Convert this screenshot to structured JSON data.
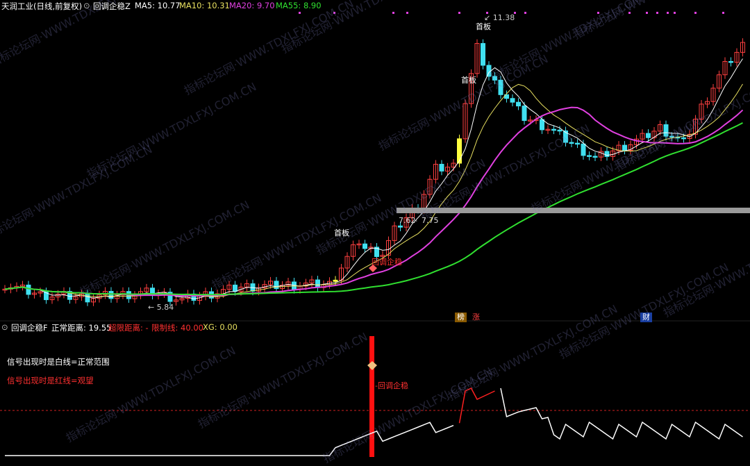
{
  "header": {
    "stock": "天润工业(日线,前复权)",
    "indicator": "回调企稳Z",
    "ma5": "MA5: 10.77",
    "ma10": "MA10: 10.31",
    "ma20": "MA20: 9.70",
    "ma55": "MA55: 8.90"
  },
  "colors": {
    "up": "#ff4040",
    "down": "#40e0f0",
    "ma5": "#ffffff",
    "ma10": "#e8e060",
    "ma20": "#e040e0",
    "ma55": "#30e030",
    "limit": "#ffff40"
  },
  "price_labels": {
    "high": "11.38",
    "low": "5.84",
    "range_low": "7.62",
    "range_high": "7.75"
  },
  "signals": {
    "first_board_1": "首板",
    "first_board_2": "首板",
    "first_board_3": "首板",
    "pullback": "回调企稳"
  },
  "tags": {
    "bang": "榜",
    "zhang": "涨",
    "cai": "财"
  },
  "sub_header": {
    "indicator": "回调企稳F",
    "normal_distance": "正常距离: 19.55",
    "over_limit": "超限距离: -",
    "limit_line": "限制线: 40.00",
    "xg": "XG: 0.00"
  },
  "legend": {
    "white_line": "信号出现时是白线=正常范围",
    "red_line": "信号出现时是红线=观望"
  },
  "sub_signal": "回调企稳",
  "watermark": "指标论坛网·WWW.TDXLFXJ.COM.CN"
}
